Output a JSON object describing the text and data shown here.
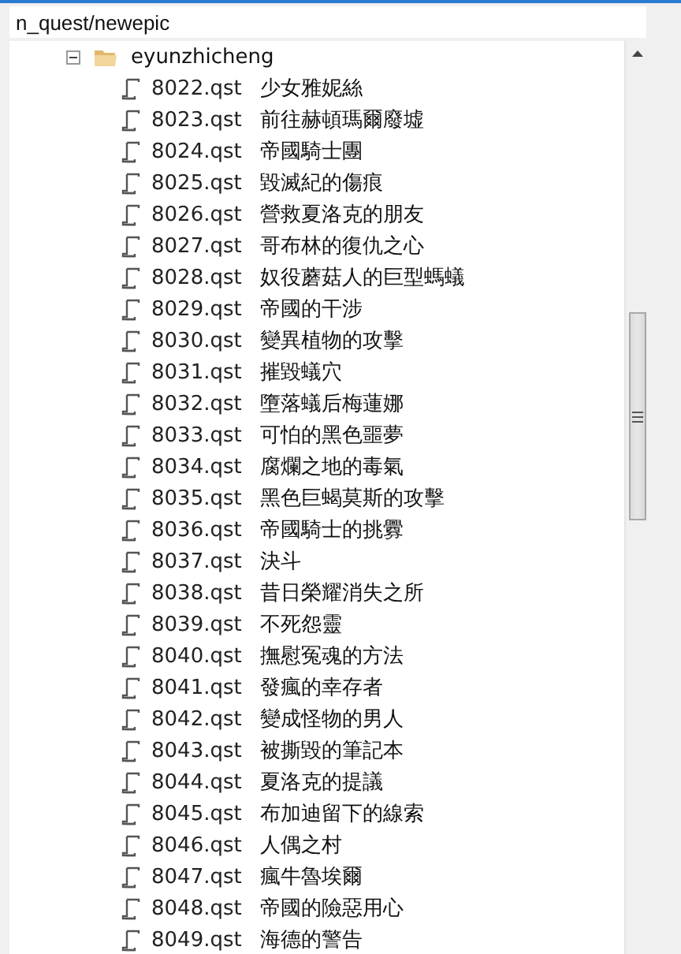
{
  "path_field": {
    "value": "n_quest/newepic"
  },
  "tree": {
    "items": [
      {
        "label": "eyunzhicheng",
        "expanded": true,
        "children": [
          {
            "file": "8022.qst",
            "title": "少女雅妮絲"
          },
          {
            "file": "8023.qst",
            "title": "前往赫頓瑪爾廢墟"
          },
          {
            "file": "8024.qst",
            "title": "帝國騎士團"
          },
          {
            "file": "8025.qst",
            "title": "毀滅紀的傷痕"
          },
          {
            "file": "8026.qst",
            "title": "營救夏洛克的朋友"
          },
          {
            "file": "8027.qst",
            "title": "哥布林的復仇之心"
          },
          {
            "file": "8028.qst",
            "title": "奴役蘑菇人的巨型螞蟻"
          },
          {
            "file": "8029.qst",
            "title": "帝國的干涉"
          },
          {
            "file": "8030.qst",
            "title": "變異植物的攻擊"
          },
          {
            "file": "8031.qst",
            "title": "摧毀蟻穴"
          },
          {
            "file": "8032.qst",
            "title": "墮落蟻后梅蓮娜"
          },
          {
            "file": "8033.qst",
            "title": "可怕的黑色噩夢"
          },
          {
            "file": "8034.qst",
            "title": "腐爛之地的毒氣"
          },
          {
            "file": "8035.qst",
            "title": "黑色巨蝎莫斯的攻擊"
          },
          {
            "file": "8036.qst",
            "title": "帝國騎士的挑釁"
          },
          {
            "file": "8037.qst",
            "title": "決斗"
          },
          {
            "file": "8038.qst",
            "title": "昔日榮耀消失之所"
          },
          {
            "file": "8039.qst",
            "title": "不死怨靈"
          },
          {
            "file": "8040.qst",
            "title": "撫慰冤魂的方法"
          },
          {
            "file": "8041.qst",
            "title": "發瘋的幸存者"
          },
          {
            "file": "8042.qst",
            "title": "變成怪物的男人"
          },
          {
            "file": "8043.qst",
            "title": "被撕毀的筆記本"
          },
          {
            "file": "8044.qst",
            "title": "夏洛克的提議"
          },
          {
            "file": "8045.qst",
            "title": "布加迪留下的線索"
          },
          {
            "file": "8046.qst",
            "title": "人偶之村"
          },
          {
            "file": "8047.qst",
            "title": "瘋牛魯埃爾"
          },
          {
            "file": "8048.qst",
            "title": "帝國的險惡用心"
          },
          {
            "file": "8049.qst",
            "title": "海德的警告"
          }
        ]
      }
    ]
  }
}
